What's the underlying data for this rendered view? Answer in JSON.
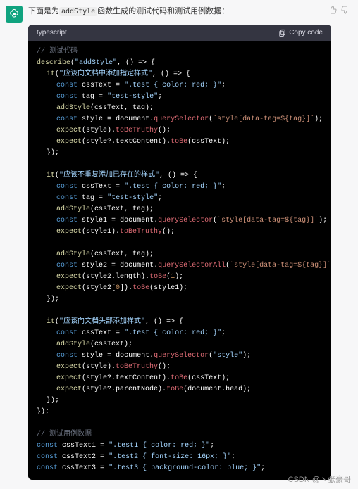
{
  "intro": {
    "prefix": "下面是为",
    "func": "addStyle",
    "suffix": "函数生成的测试代码和测试用例数据："
  },
  "header": {
    "lang": "typescript",
    "copy": "Copy code"
  },
  "code": {
    "comment1": "// 测试代码",
    "describe": "describe",
    "describeArg": "\"addStyle\"",
    "arrow": ", () => {",
    "it": "it",
    "it1": "\"应该向文档中添加指定样式\"",
    "const": "const",
    "cssText": "cssText",
    "eq": " = ",
    "cssVal": "\".test { color: red; }\"",
    "semi": ";",
    "tag": "tag",
    "tagVal": "\"test-style\"",
    "addStyle": "addStyle",
    "addStyleArgs": "(cssText, tag)",
    "addStyleArgs1": "(cssText)",
    "style": "style",
    "document": "document",
    "querySelector": "querySelector",
    "qsArg1": "`style[data-tag=${tag}]`",
    "expect": "expect",
    "toBeTruthy": "toBeTruthy",
    "toBe": "toBe",
    "textContent": "textContent",
    "close": "});",
    "it2": "\"应该不重复添加已存在的样式\"",
    "style1": "style1",
    "style2": "style2",
    "querySelectorAll": "querySelectorAll",
    "length": "length",
    "one": "1",
    "zero": "0",
    "it3": "\"应该向文档头部添加样式\"",
    "qsStyle": "\"style\"",
    "parentNode": "parentNode",
    "head": "head",
    "comment2": "// 测试用例数据",
    "cssText1": "cssText1",
    "cssText2": "cssText2",
    "cssText3": "cssText3",
    "cssVal1": "\".test1 { color: red; }\"",
    "cssVal2": "\".test2 { font-size: 16px; }\"",
    "cssVal3": "\".test3 { background-color: blue; }\""
  },
  "watermark": "CSDN @丶张豪哥"
}
